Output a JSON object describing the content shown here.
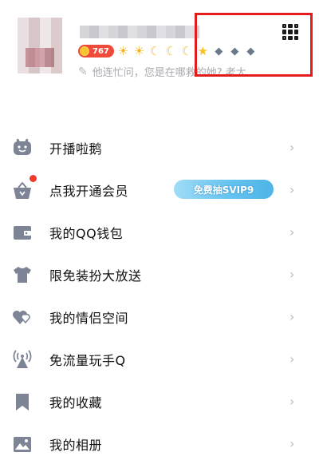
{
  "profile": {
    "level_number": "767",
    "signature": "他连忙问，您是在哪救的她? 老太"
  },
  "menu": [
    {
      "label": "开播啦鹅",
      "icon": "tv-icon"
    },
    {
      "label": "点我开通会员",
      "icon": "vip-basket-icon",
      "promo": "免费抽SVIP9",
      "has_badge": true
    },
    {
      "label": "我的QQ钱包",
      "icon": "wallet-icon"
    },
    {
      "label": "限免装扮大放送",
      "icon": "tshirt-icon"
    },
    {
      "label": "我的情侣空间",
      "icon": "hearts-icon"
    },
    {
      "label": "免流量玩手Q",
      "icon": "antenna-icon"
    },
    {
      "label": "我的收藏",
      "icon": "bookmark-icon"
    },
    {
      "label": "我的相册",
      "icon": "photo-icon"
    }
  ],
  "colors": {
    "icon": "#7c8496",
    "accent_red": "#e21c1c",
    "chevron": "#b9b9bd"
  }
}
